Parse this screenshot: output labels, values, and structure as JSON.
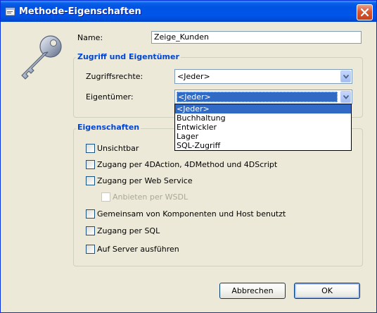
{
  "window": {
    "title": "Methode-Eigenschaften"
  },
  "form": {
    "name_label": "Name:",
    "name_value": "Zeige_Kunden"
  },
  "access_group": {
    "title": "Zugriff und Eigentümer",
    "rights_label": "Zugriffsrechte:",
    "rights_value": "<Jeder>",
    "owner_label": "Eigentümer:",
    "owner_value": "<Jeder>",
    "owner_options": [
      "<Jeder>",
      "Buchhaltung",
      "Entwickler",
      "Lager",
      "SQL-Zugriff"
    ]
  },
  "properties_group": {
    "title": "Eigenschaften",
    "checkboxes": [
      {
        "label": "Unsichtbar",
        "checked": false,
        "enabled": true
      },
      {
        "label": "Zugang per 4DAction, 4DMethod und 4DScript",
        "checked": false,
        "enabled": true
      },
      {
        "label": "Zugang per Web Service",
        "checked": false,
        "enabled": true
      },
      {
        "label": "Anbieten per WSDL",
        "checked": false,
        "enabled": false
      },
      {
        "label": "Gemeinsam von Komponenten und Host benutzt",
        "checked": false,
        "enabled": true
      },
      {
        "label": "Zugang per SQL",
        "checked": false,
        "enabled": true
      },
      {
        "label": "Auf Server ausführen",
        "checked": false,
        "enabled": true
      }
    ]
  },
  "buttons": {
    "cancel": "Abbrechen",
    "ok": "OK"
  },
  "colors": {
    "titlebar": "#0054e3",
    "group_title": "#0046d5",
    "selection": "#316ac5",
    "close": "#d9582f"
  }
}
